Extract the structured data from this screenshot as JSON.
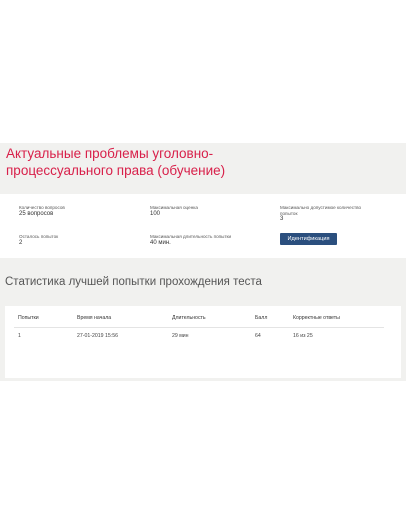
{
  "course": {
    "title_line1": "Актуальные проблемы уголовно-",
    "title_line2": "процессуального права (обучение)"
  },
  "info": {
    "questions_label": "Количество вопросов",
    "questions_value": "25 вопросов",
    "max_score_label": "Максимальная оценка",
    "max_score_value": "100",
    "max_attempts_label_1": "Максимально допустимое количество",
    "max_attempts_label_2": "попыток",
    "max_attempts_value": "3",
    "attempts_left_label": "Осталось попыток",
    "attempts_left_value": "2",
    "max_duration_label": "Максимальная длительность попытки",
    "max_duration_value": "40 мин.",
    "identify_button": "Идентификация"
  },
  "stats": {
    "title": "Статистика лучшей попытки прохождения теста",
    "columns": [
      "Попытки",
      "Время начала",
      "Длительность",
      "Балл",
      "Корректные ответы"
    ],
    "rows": [
      [
        "1",
        "27-01-2019 15:56",
        "29 мин",
        "64",
        "16 из 25"
      ]
    ]
  },
  "colors": {
    "title": "#d8204a",
    "button": "#2b4f7e",
    "band": "#f1f1ef"
  }
}
